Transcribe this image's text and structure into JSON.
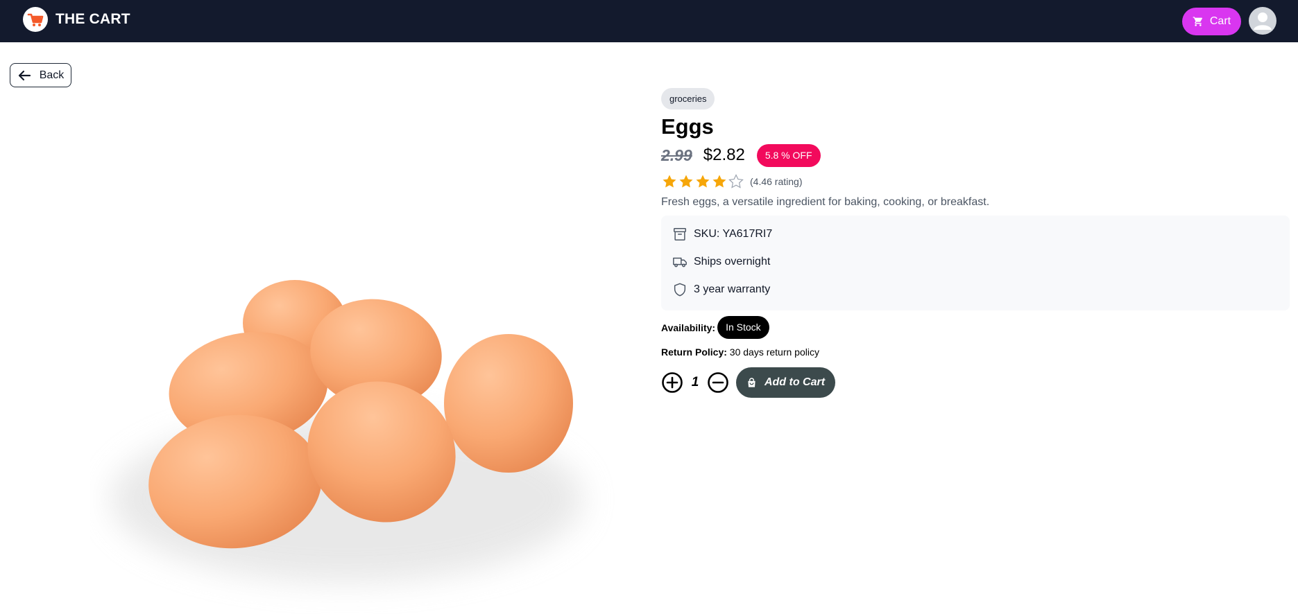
{
  "header": {
    "brand_name": "THE CART",
    "cart_label": "Cart",
    "logo_icon": "shopping-cart-logo-icon",
    "colors": {
      "bar": "#131a2d",
      "cart_button": "#d936f0",
      "logo_accent": "#f45a2a"
    }
  },
  "back_label": "Back",
  "product": {
    "category": "groceries",
    "title": "Eggs",
    "original_price": "2.99",
    "price": "$2.82",
    "discount": "5.8 % OFF",
    "rating": 4.46,
    "rating_text": "(4.46 rating)",
    "max_stars": 5,
    "description": "Fresh eggs, a versatile ingredient for baking, cooking, or breakfast.",
    "info": [
      {
        "icon": "archive-box-icon",
        "text": "SKU: YA617RI7"
      },
      {
        "icon": "truck-icon",
        "text": "Ships overnight"
      },
      {
        "icon": "shield-icon",
        "text": "3 year warranty"
      }
    ],
    "availability_label": "Availability:",
    "availability": "In Stock",
    "return_policy_label": "Return Policy:",
    "return_policy": "30 days return policy",
    "quantity": "1",
    "add_to_cart_label": "Add to Cart",
    "colors": {
      "discount": "#f20a5c",
      "star": "#f6a609",
      "add_to_cart": "#3c4a4c",
      "egg": "#f7a06a"
    }
  }
}
